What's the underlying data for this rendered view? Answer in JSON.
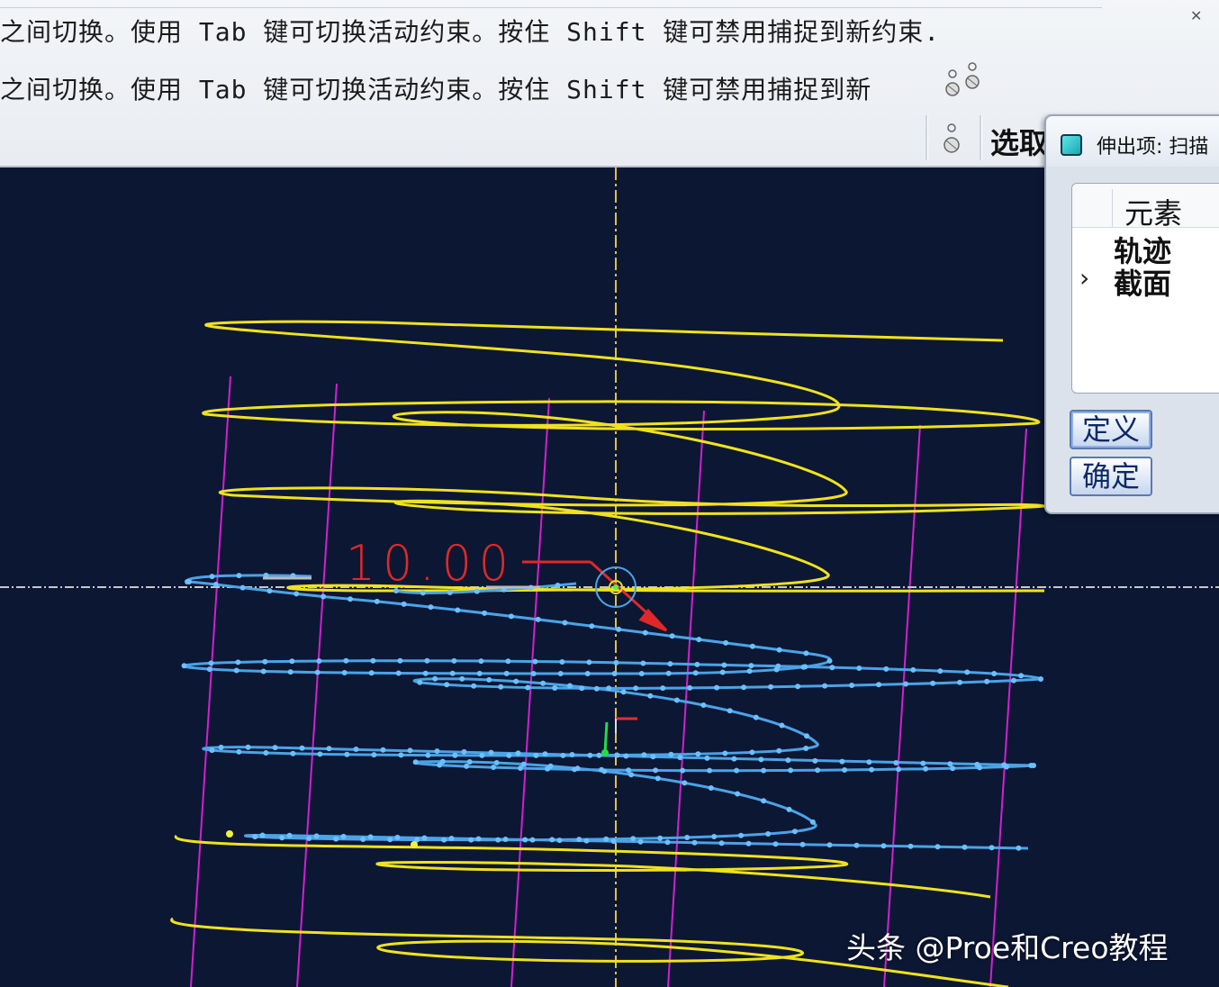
{
  "message_area": {
    "line1": "之间切换。使用 Tab 键可切换活动约束。按住 Shift 键可禁用捕捉到新约束.",
    "line2": "之间切换。使用 Tab 键可切换活动约束。按住 Shift 键可禁用捕捉到新",
    "select_label": "选取"
  },
  "viewport": {
    "dimension_value": "10.00",
    "colors": {
      "background": "#0c1733",
      "helix": "#f0e21e",
      "section_curve": "#4aa3e6",
      "guide_lines": "#d21fd2",
      "dimension": "#e02828",
      "centerline": "#e0c040"
    }
  },
  "dialog": {
    "title": "伸出项: 扫描",
    "list_header": "元素",
    "items": [
      "轨迹",
      "截面"
    ],
    "define_label": "定义",
    "ok_label": "确定"
  },
  "watermark": "头条 @Proe和Creo教程"
}
